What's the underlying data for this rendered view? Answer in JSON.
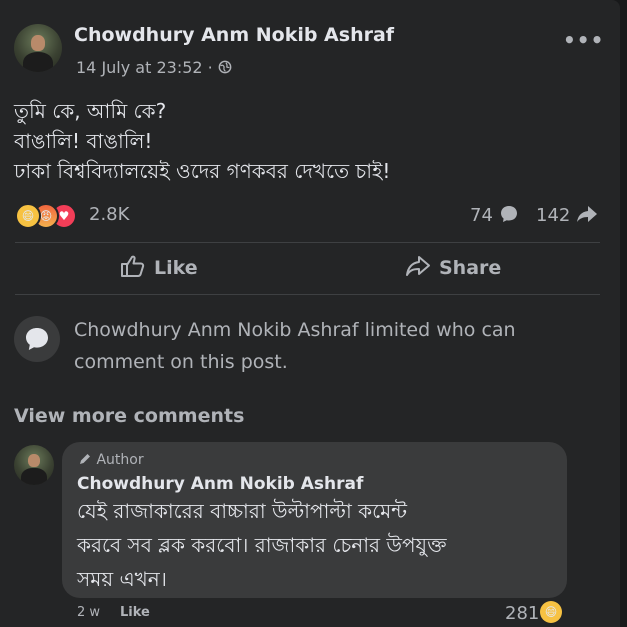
{
  "post": {
    "author": "Chowdhury Anm Nokib Ashraf",
    "time": "14 July at 23:52 · ",
    "audience_icon": "globe-icon",
    "more_label": "•••",
    "text_lines": [
      "তুমি কে, আমি কে?",
      "বাঙালি! বাঙালি!",
      "ঢাকা বিশ্ববিদ্যালয়েই ওদের গণকবর দেখতে চাই!"
    ],
    "reactions": {
      "icons": [
        "laugh-react-icon",
        "angry-react-icon",
        "love-react-icon"
      ],
      "count": "2.8K"
    },
    "comments_count": "74",
    "shares_count": "142"
  },
  "actions": {
    "like_label": "Like",
    "share_label": "Share"
  },
  "comment_limit": {
    "message": "Chowdhury Anm Nokib Ashraf limited who can comment on this post."
  },
  "view_more_label": "View more comments",
  "comment": {
    "badge": "Author",
    "author": "Chowdhury Anm Nokib Ashraf",
    "text_lines": [
      "যেই রাজাকারের বাচ্চারা উল্টাপাল্টা কমেন্ট",
      "করবে সব ব্লক করবো। রাজাকার চেনার উপযুক্ত",
      "সময় এখন।"
    ],
    "time": "2 w",
    "like_label": "Like",
    "reaction_count": "281",
    "reaction_icon": "laugh-react-icon"
  },
  "colors": {
    "background": "#242526",
    "text_primary": "#e4e6eb",
    "text_secondary": "#b0b3b8",
    "bubble": "#3a3b3c"
  }
}
